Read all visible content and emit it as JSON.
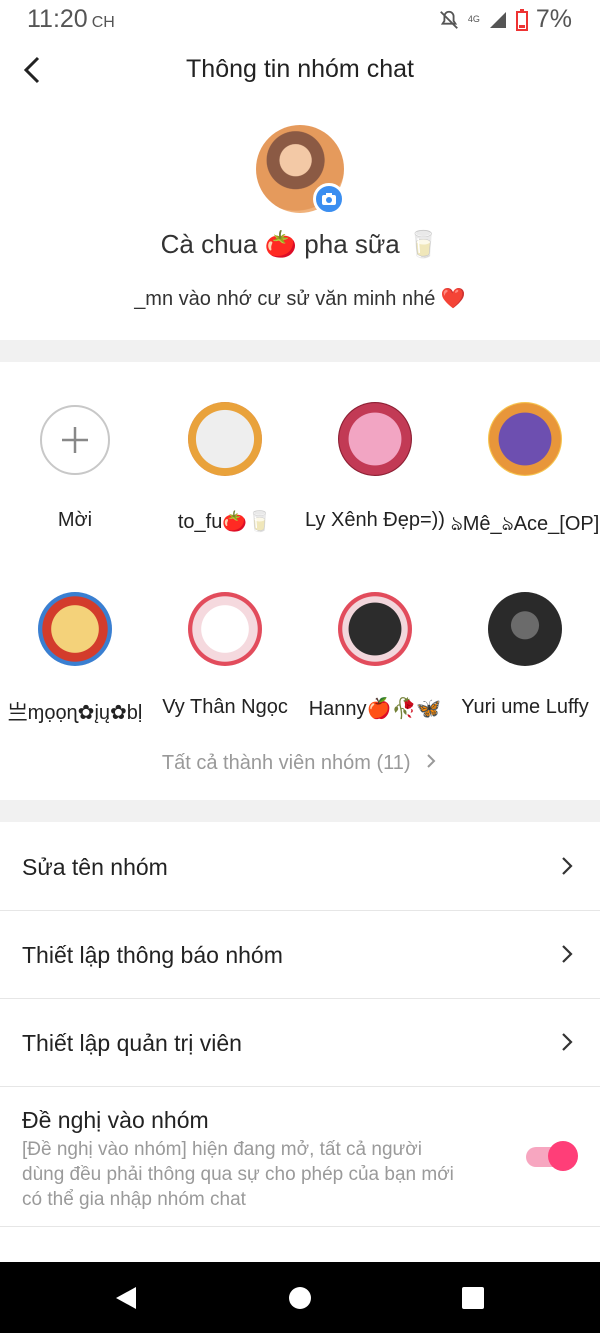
{
  "status": {
    "time": "11:20",
    "ampm": "CH",
    "battery": "7%",
    "network": "4G"
  },
  "header": {
    "title": "Thông tin nhóm chat"
  },
  "group": {
    "name": "Cà chua 🍅 pha sữa 🥛",
    "description": "_mn vào nhớ cư sử văn minh nhé ❤️"
  },
  "members": {
    "invite_label": "Mời",
    "list": [
      {
        "name": "to_fu🍅🥛"
      },
      {
        "name": "Ly Xênh Đẹp=))"
      },
      {
        "name": "ঌMê_ঌAce_[OP]"
      },
      {
        "name": "亗ɱọọɳ✿įų✿bḷ"
      },
      {
        "name": "Vy Thân Ngọc"
      },
      {
        "name": "Hanny🍎🥀🦋"
      },
      {
        "name": "Yuri ume Luffy"
      }
    ],
    "see_all": "Tất cả thành viên nhóm (11)"
  },
  "settings": {
    "rename": "Sửa tên nhóm",
    "notifications": "Thiết lập thông báo nhóm",
    "admins": "Thiết lập quản trị viên",
    "join_request": {
      "label": "Đề nghị vào nhóm",
      "description": "[Đề nghị vào nhóm] hiện đang mở, tất cả người dùng đều phải thông qua sự cho phép của bạn mới có thể gia nhập nhóm chat",
      "enabled": true
    }
  },
  "colors": {
    "accent": "#ff3e78",
    "toggle_track": "#f7a6c0",
    "camera_badge": "#3b8ef0",
    "muted_text": "#9a9a9a",
    "section_gap": "#f1f1f1"
  }
}
